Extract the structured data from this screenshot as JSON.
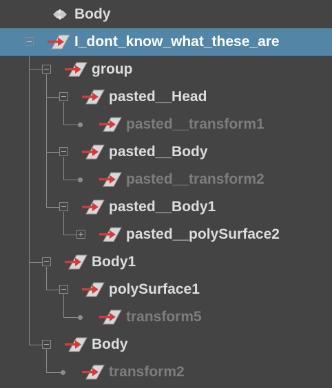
{
  "outliner": {
    "colors": {
      "background": "#444444",
      "selection": "#5285a6",
      "text": "#dddddd",
      "text_dim": "#7d7d7d",
      "tree_line": "#8a8a8a",
      "icon_arrow": "#d63a3a"
    },
    "rows": [
      {
        "label": "Body",
        "icon": "set-icon",
        "expander": "none",
        "selected": false,
        "dim": false
      },
      {
        "label": "I_dont_know_what_these_are",
        "icon": "transform-icon",
        "expander": "expanded",
        "selected": true,
        "dim": false
      },
      {
        "label": "group",
        "icon": "transform-icon",
        "expander": "expanded",
        "selected": false,
        "dim": false
      },
      {
        "label": "pasted__Head",
        "icon": "transform-icon",
        "expander": "expanded",
        "selected": false,
        "dim": false
      },
      {
        "label": "pasted__transform1",
        "icon": "transform-icon",
        "expander": "leaf",
        "selected": false,
        "dim": true
      },
      {
        "label": "pasted__Body",
        "icon": "transform-icon",
        "expander": "expanded",
        "selected": false,
        "dim": false
      },
      {
        "label": "pasted__transform2",
        "icon": "transform-icon",
        "expander": "leaf",
        "selected": false,
        "dim": true
      },
      {
        "label": "pasted__Body1",
        "icon": "transform-icon",
        "expander": "expanded",
        "selected": false,
        "dim": false
      },
      {
        "label": "pasted__polySurface2",
        "icon": "transform-icon",
        "expander": "collapsed",
        "selected": false,
        "dim": false
      },
      {
        "label": "Body1",
        "icon": "transform-icon",
        "expander": "expanded",
        "selected": false,
        "dim": false
      },
      {
        "label": "polySurface1",
        "icon": "transform-icon",
        "expander": "expanded",
        "selected": false,
        "dim": false
      },
      {
        "label": "transform5",
        "icon": "transform-icon",
        "expander": "leaf",
        "selected": false,
        "dim": true
      },
      {
        "label": "Body",
        "icon": "transform-icon",
        "expander": "expanded",
        "selected": false,
        "dim": false
      },
      {
        "label": "transform2",
        "icon": "transform-icon",
        "expander": "leaf",
        "selected": false,
        "dim": true
      }
    ]
  }
}
